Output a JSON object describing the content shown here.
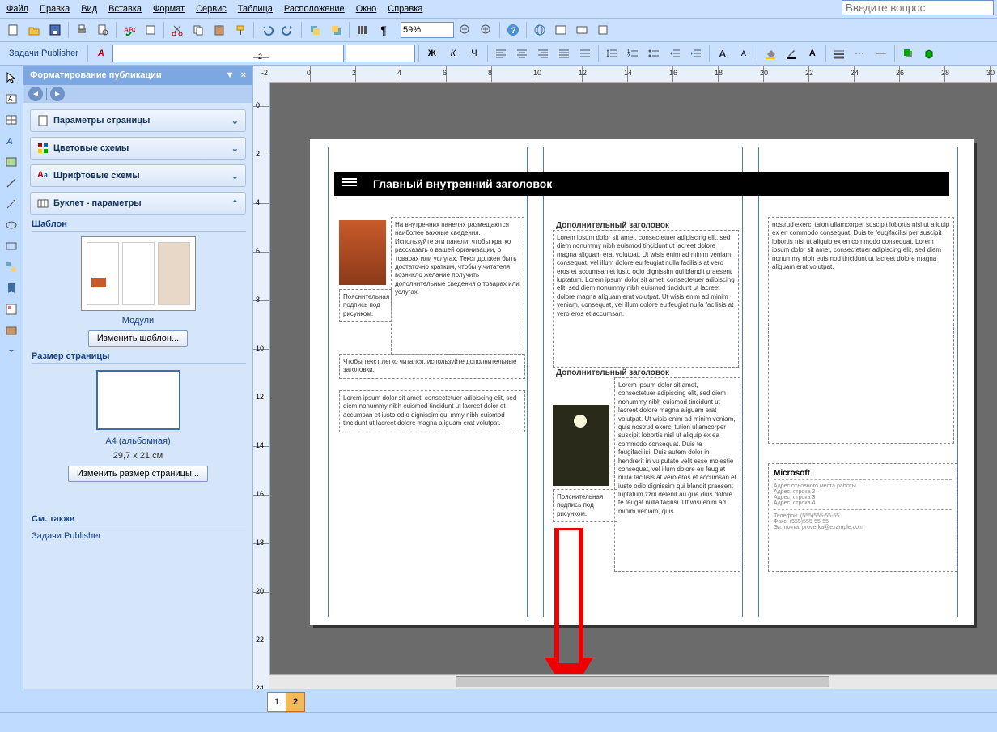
{
  "menu": {
    "file": "Файл",
    "edit": "Правка",
    "view": "Вид",
    "insert": "Вставка",
    "format": "Формат",
    "service": "Сервис",
    "table": "Таблица",
    "layout": "Расположение",
    "window": "Окно",
    "help": "Справка"
  },
  "question_placeholder": "Введите вопрос",
  "zoom": "59%",
  "task_label": "Задачи Publisher",
  "panel": {
    "title": "Форматирование публикации",
    "sections": {
      "page_params": "Параметры страницы",
      "color_schemes": "Цветовые схемы",
      "font_schemes": "Шрифтовые схемы",
      "brochure": "Буклет - параметры"
    },
    "template_head": "Шаблон",
    "template_name": "Модули",
    "change_template": "Изменить шаблон...",
    "pagesize_head": "Размер страницы",
    "pagesize_name": "A4 (альбомная)",
    "pagesize_dim": "29,7 x 21 см",
    "change_pagesize": "Изменить размер страницы...",
    "seealso": "См. также",
    "link_tasks": "Задачи Publisher"
  },
  "doc": {
    "main_title": "Главный внутренний заголовок",
    "col1_text": "На внутренних панелях размещаются наиболее важные сведения. Используйте эти панели, чтобы кратко рассказать о вашей организации, о товарах или услугах. Текст должен быть достаточно кратким, чтобы у читателя возникло желание получить дополнительные сведения о товарах или услугах.",
    "col1_caption": "Пояснительная подпись под рисунком.",
    "col1_tip": "Чтобы текст легко читался, используйте дополнительные заголовки.",
    "col1_lorem": "Lorem ipsum dolor sit amet, consectetuer adipiscing elit, sed diem nonummy nibh euismod tincidunt ut lacreet dolor et accumsan et iusto odio dignissim qui mmy nibh euismod tincidunt ut lacreet dolore magna aliguam erat volutpat.",
    "col2_h1": "Дополнительный заголовок",
    "col2_t1": "Lorem ipsum dolor sit amet, consectetuer adipiscing elit, sed diem nonummy nibh euismod tincidunt ut lacreet dolore magna aliguam erat volutpat. Ut wisis enim ad minim veniam, consequat, vel illum dolore eu feugiat nulla facilisis at vero eros et accumsan et iusto odio dignissim qui blandit praesent luptatum. Lorem ipsum dolor sit amet, consectetuer adipiscing elit, sed diem nonummy nibh euismod tincidunt ut lacreet dolore magna aliguam erat volutpat. Ut wisis enim ad minim veniam, consequat, vel illum dolore eu feugiat nulla facilisis at vero eros et accumsan.",
    "col2_h2": "Дополнительный заголовок",
    "col2_t2": "Lorem ipsum dolor sit amet, consectetuer adipiscing elit, sed diem nonummy nibh euismod tincidunt ut lacreet dolore magna aliguam erat volutpat. Ut wisis enim ad minim veniam, quis nostrud exerci tution ullamcorper suscipit lobortis nisl ut aliquip ex ea commodo consequat. Duis te feugifacilisi. Duis autem dolor in hendrerit in vulputate velit esse molestie consequat, vel illum dolore eu feugiat nulla facilisis at vero eros et accumsan et iusto odio dignissim qui blandit praesent luptatum zzril delenit au gue duis dolore te feugat nulla facilisi. Ut wisi enim ad minim veniam, quis",
    "col2_caption": "Пояснительная подпись под рисунком.",
    "col3_t": "nostrud exerci taion ullamcorper suscipit lobortis nisl ut aliquip ex en commodo consequat. Duis te feugifacilisi per suscipit lobortis nisl ut aliquip ex en commodo consequat. Lorem ipsum dolor sit amet, consectetuer adipiscing elit, sed diem nonummy nibh euismod tincidunt ut lacreet dolore magna aliguam erat volutpat.",
    "micro_title": "Microsoft",
    "micro_addr": "Адрес основного места работы\nАдрес, строка 2\nАдрес, строка 3\nАдрес, строка 4",
    "micro_contact": "Телефон: (555)555-55-55\nФакс: (555)555-55-55\nЭл. почта: proverka@example.com"
  },
  "pages": {
    "p1": "1",
    "p2": "2"
  }
}
